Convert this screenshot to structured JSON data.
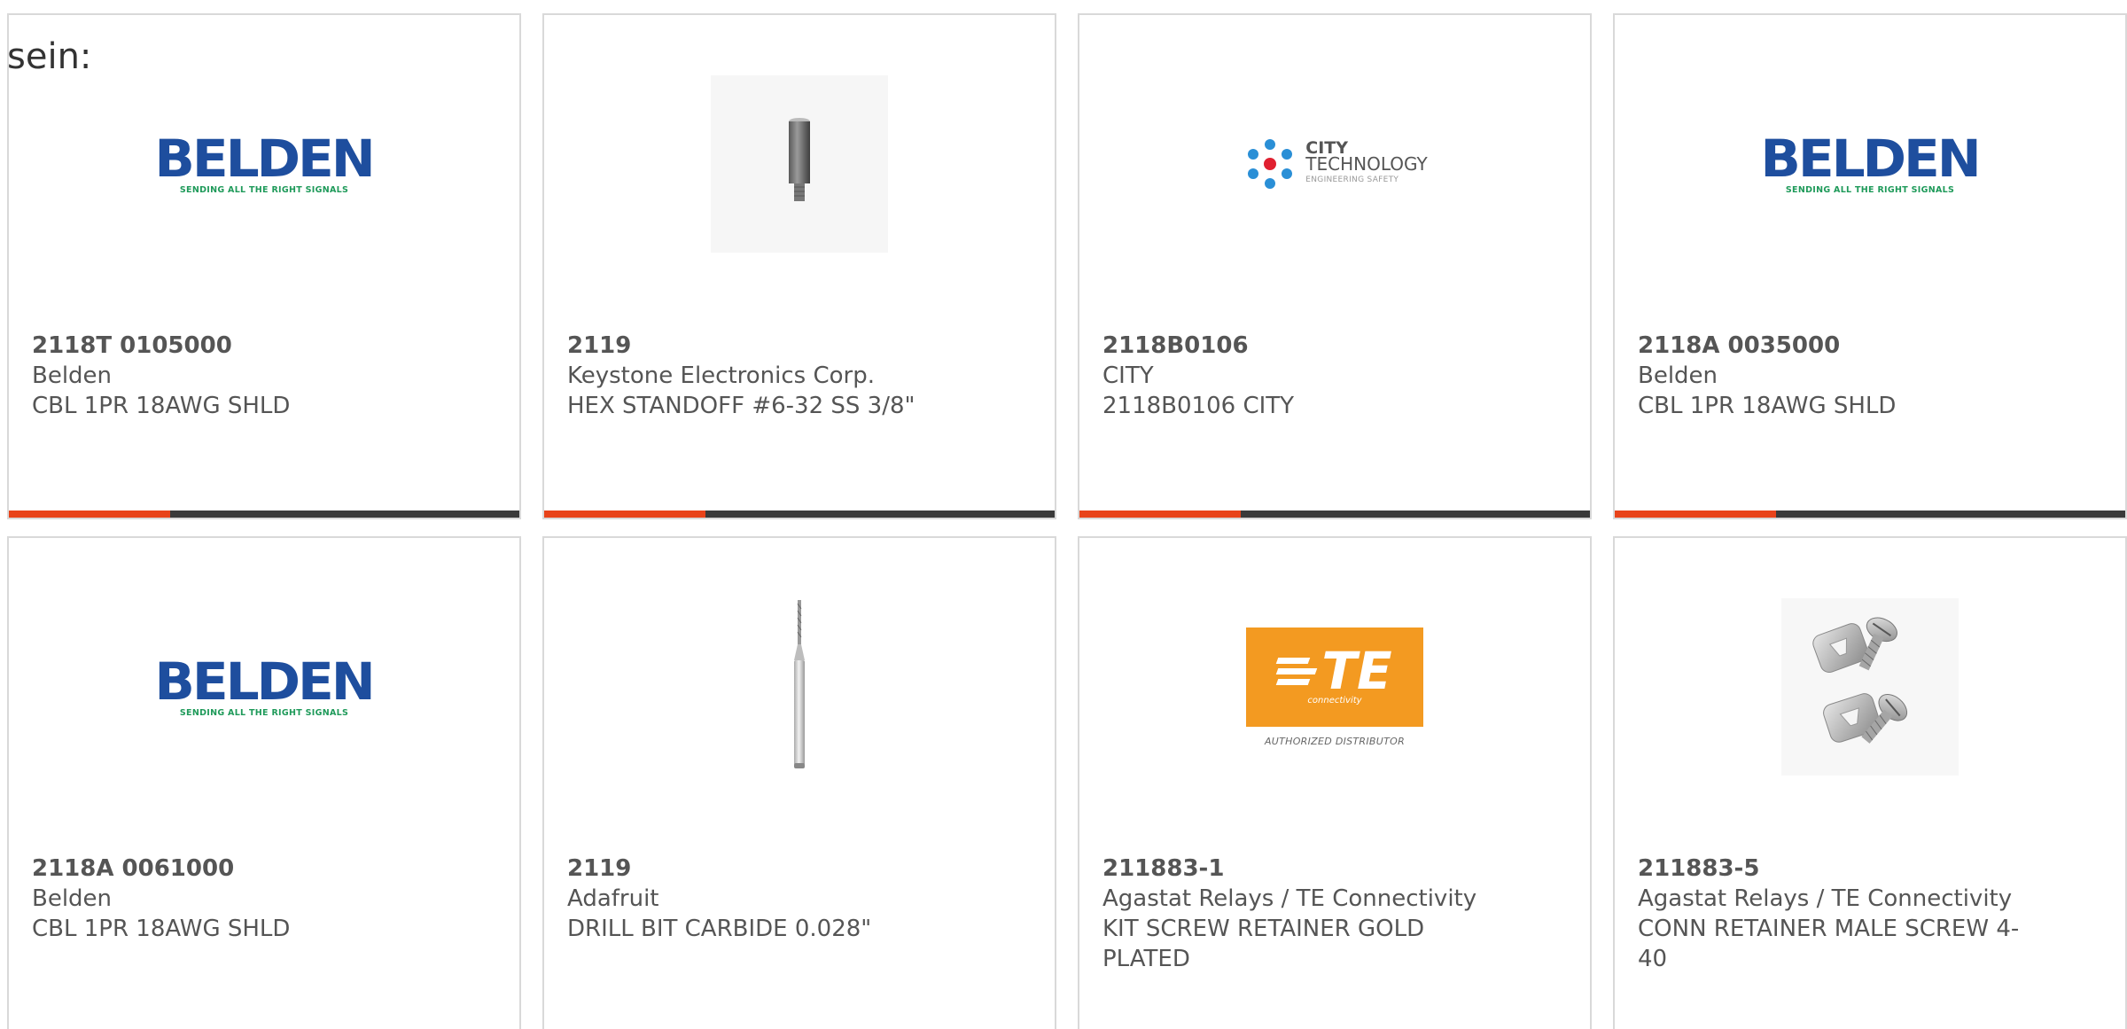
{
  "fragment_text": "sein:",
  "products": [
    {
      "part_number": "2118T 0105000",
      "manufacturer": "Belden",
      "description": "CBL 1PR 18AWG SHLD",
      "image": "belden-logo"
    },
    {
      "part_number": "2119",
      "manufacturer": "Keystone Electronics Corp.",
      "description": "HEX STANDOFF #6-32 SS 3/8\"",
      "image": "hex-standoff-photo"
    },
    {
      "part_number": "2118B0106",
      "manufacturer": "CITY",
      "description": "2118B0106 CITY",
      "image": "city-technology-logo"
    },
    {
      "part_number": "2118A 0035000",
      "manufacturer": "Belden",
      "description": "CBL 1PR 18AWG SHLD",
      "image": "belden-logo"
    },
    {
      "part_number": "2118A 0061000",
      "manufacturer": "Belden",
      "description": "CBL 1PR 18AWG SHLD",
      "image": "belden-logo"
    },
    {
      "part_number": "2119",
      "manufacturer": "Adafruit",
      "description": "DRILL BIT CARBIDE 0.028\"",
      "image": "drill-bit-photo"
    },
    {
      "part_number": "211883-1",
      "manufacturer": "Agastat Relays / TE Connectivity",
      "description": "KIT SCREW RETAINER GOLD PLATED",
      "image": "te-connectivity-logo"
    },
    {
      "part_number": "211883-5",
      "manufacturer": "Agastat Relays / TE Connectivity",
      "description": "CONN RETAINER MALE SCREW 4-40",
      "image": "screw-retainer-photo"
    }
  ],
  "logos": {
    "belden_word": "BELDEN",
    "belden_tagline": "SENDING ALL THE RIGHT SIGNALS",
    "city_line1": "CITY",
    "city_line2": "TECHNOLOGY",
    "city_line3": "ENGINEERING SAFETY",
    "te_word": "TE",
    "te_sub": "connectivity",
    "te_authorized": "AUTHORIZED DISTRIBUTOR"
  },
  "colors": {
    "accent_bar": "#e8431a",
    "bar_dark": "#3a3a3a",
    "belden_blue": "#1e4e9e",
    "belden_green": "#1f9a5a",
    "te_orange": "#f39a21"
  }
}
